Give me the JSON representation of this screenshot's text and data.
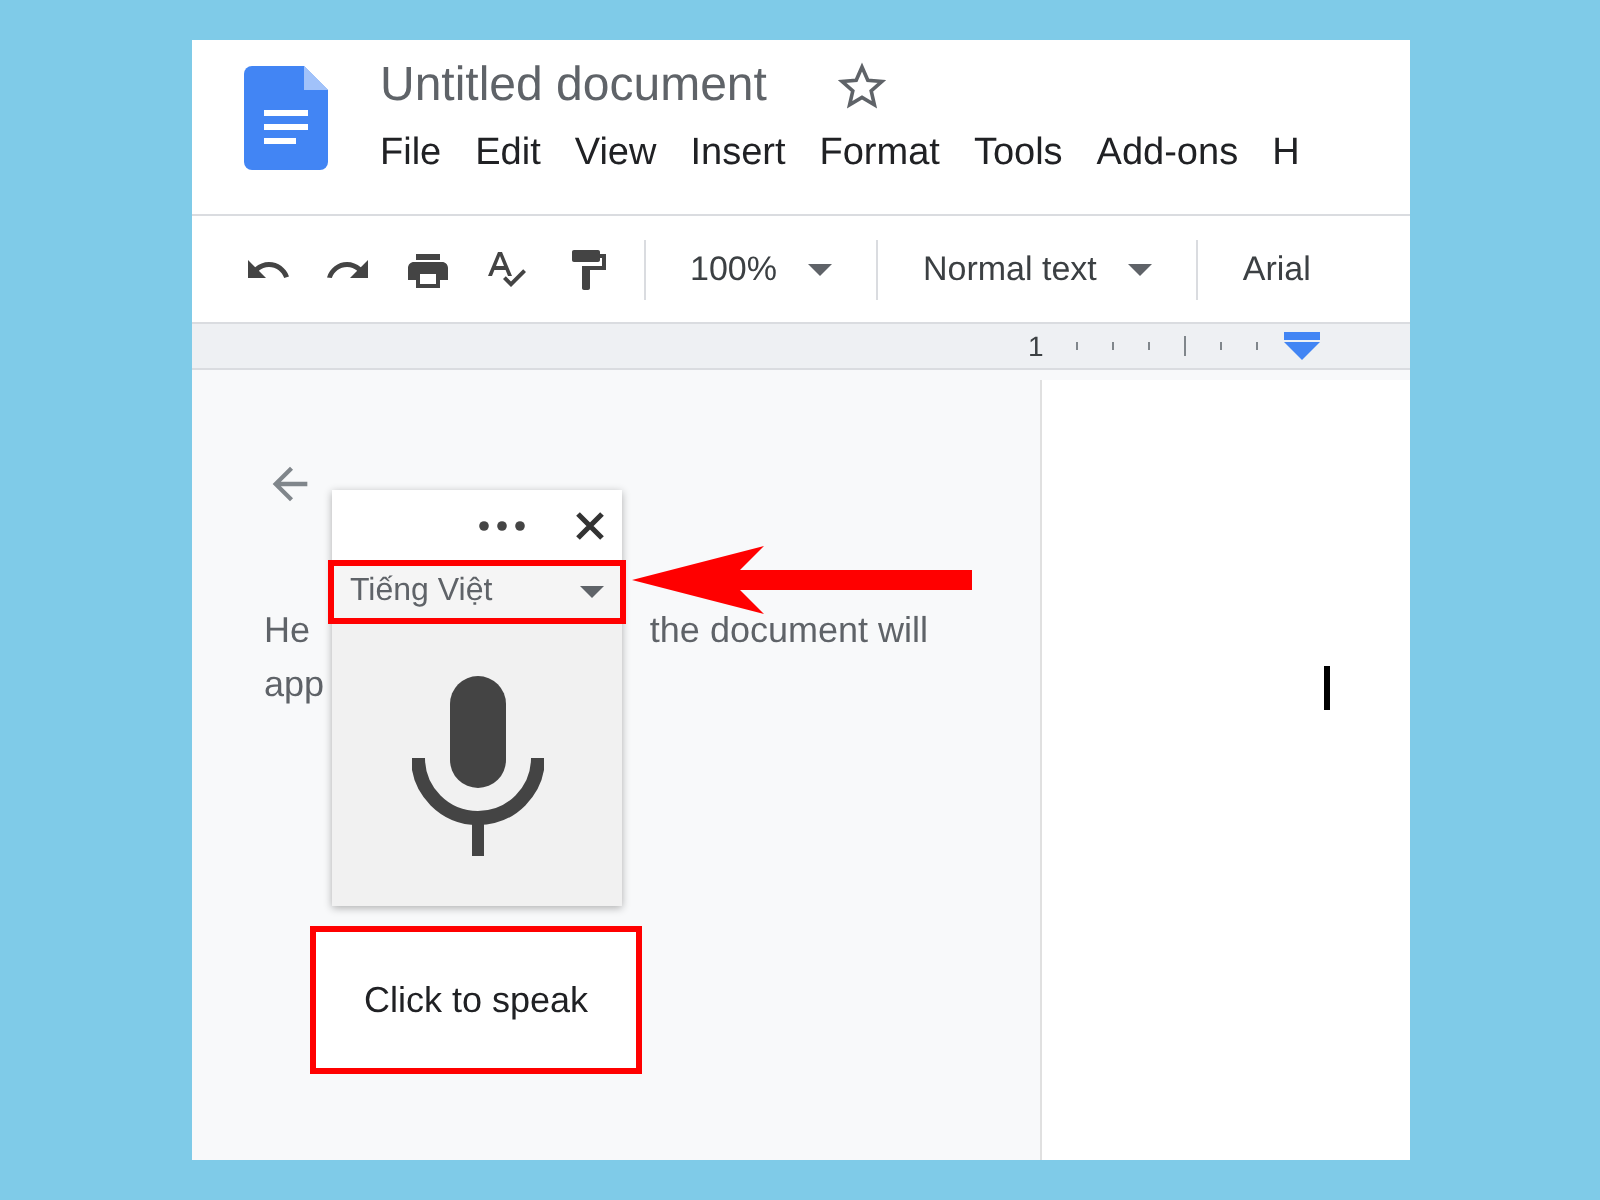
{
  "document": {
    "title": "Untitled document"
  },
  "menu": [
    "File",
    "Edit",
    "View",
    "Insert",
    "Format",
    "Tools",
    "Add-ons",
    "H"
  ],
  "toolbar": {
    "zoom": "100%",
    "style": "Normal text",
    "font": "Arial"
  },
  "ruler": {
    "marker": "1"
  },
  "voice_panel": {
    "hint_pieces": [
      "He",
      "the document will",
      "app"
    ],
    "language": "Tiếng Việt",
    "tooltip": "Click to speak"
  }
}
